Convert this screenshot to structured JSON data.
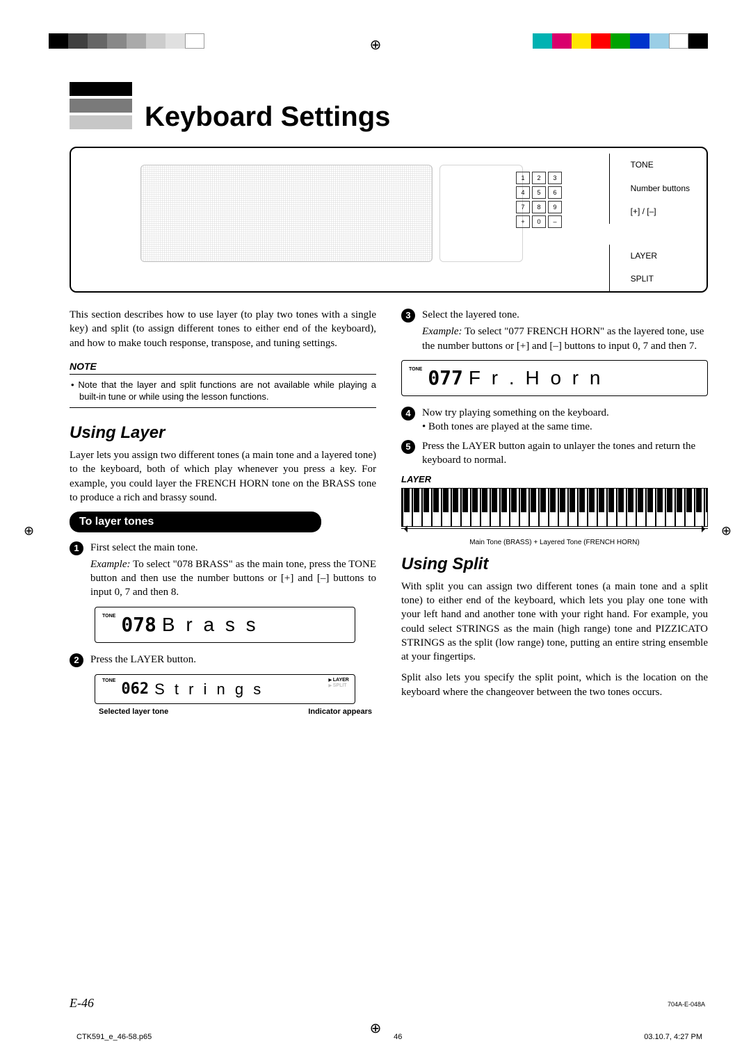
{
  "header": {
    "title": "Keyboard Settings"
  },
  "panel": {
    "labels": {
      "tone": "TONE",
      "number_buttons": "Number buttons",
      "plus_minus": "[+] / [–]",
      "layer": "LAYER",
      "split": "SPLIT"
    },
    "keypad": [
      "1",
      "2",
      "3",
      "4",
      "5",
      "6",
      "7",
      "8",
      "9",
      "+",
      "0",
      "–"
    ]
  },
  "intro": "This section describes how to use layer (to play two tones with a single key) and split (to assign different tones to either end of the keyboard), and how to make touch response, transpose, and tuning settings.",
  "note": {
    "title": "NOTE",
    "body": "Note that the layer and split functions are not available while playing a built-in tune or while using the lesson functions."
  },
  "using_layer": {
    "heading": "Using Layer",
    "body": "Layer lets you assign two different tones (a main tone and a layered tone) to the keyboard, both of which play whenever you press a key. For example, you could layer the FRENCH HORN tone on the BRASS tone to produce a rich and brassy sound."
  },
  "to_layer": {
    "heading": "To layer tones",
    "step1": "First select the main tone.",
    "step1_example_label": "Example:",
    "step1_example": "To select \"078 BRASS\" as the main tone, press the TONE button and then use the number buttons or [+] and [–] buttons to input 0, 7 and then 8.",
    "lcd1": {
      "tone": "TONE",
      "num": "078",
      "name": "B r a s s"
    },
    "step2": "Press the LAYER button.",
    "lcd2": {
      "tone": "TONE",
      "num": "062",
      "name": "S t r i n g s",
      "ind_layer": "LAYER",
      "ind_split": "SPLIT"
    },
    "caption_left": "Selected layer tone",
    "caption_right": "Indicator appears",
    "step3": "Select the layered tone.",
    "step3_example_label": "Example:",
    "step3_example": "To select \"077 FRENCH HORN\" as the layered tone, use the number buttons or [+] and [–] buttons to input 0, 7 and then 7.",
    "lcd3": {
      "tone": "TONE",
      "num": "077",
      "name": "F r . H o r n"
    },
    "step4": "Now try playing something on the keyboard.",
    "step4_sub": "Both tones are played at the same time.",
    "step5": "Press the LAYER button again to unlayer the tones and return the keyboard to normal."
  },
  "layer_fig": {
    "label": "LAYER",
    "caption": "Main Tone (BRASS) + Layered Tone (FRENCH HORN)"
  },
  "using_split": {
    "heading": "Using Split",
    "body1": "With split you can assign two different tones (a main tone and a split tone) to either end of the keyboard, which lets you play one tone with your left hand and another tone with your right hand. For example, you could select STRINGS as the main (high range) tone and PIZZICATO STRINGS as the split (low range) tone, putting an entire string ensemble at your fingertips.",
    "body2": "Split also lets you specify the split point, which is the location on the keyboard where the changeover between the two tones occurs."
  },
  "footer": {
    "page_num": "E-46",
    "doc_id": "704A-E-048A",
    "filename": "CTK591_e_46-58.p65",
    "sheet": "46",
    "timestamp": "03.10.7, 4:27 PM"
  },
  "colorbar_left": [
    "#000",
    "#404040",
    "#666",
    "#888",
    "#aaa",
    "#ccc",
    "#e0e0e0",
    "#fff",
    "#fff"
  ],
  "colorbar_right": [
    "#00b2b2",
    "#d9006c",
    "#ffe600",
    "#ff0000",
    "#00a300",
    "#0033cc",
    "#9acee6",
    "#fff",
    "#000"
  ]
}
